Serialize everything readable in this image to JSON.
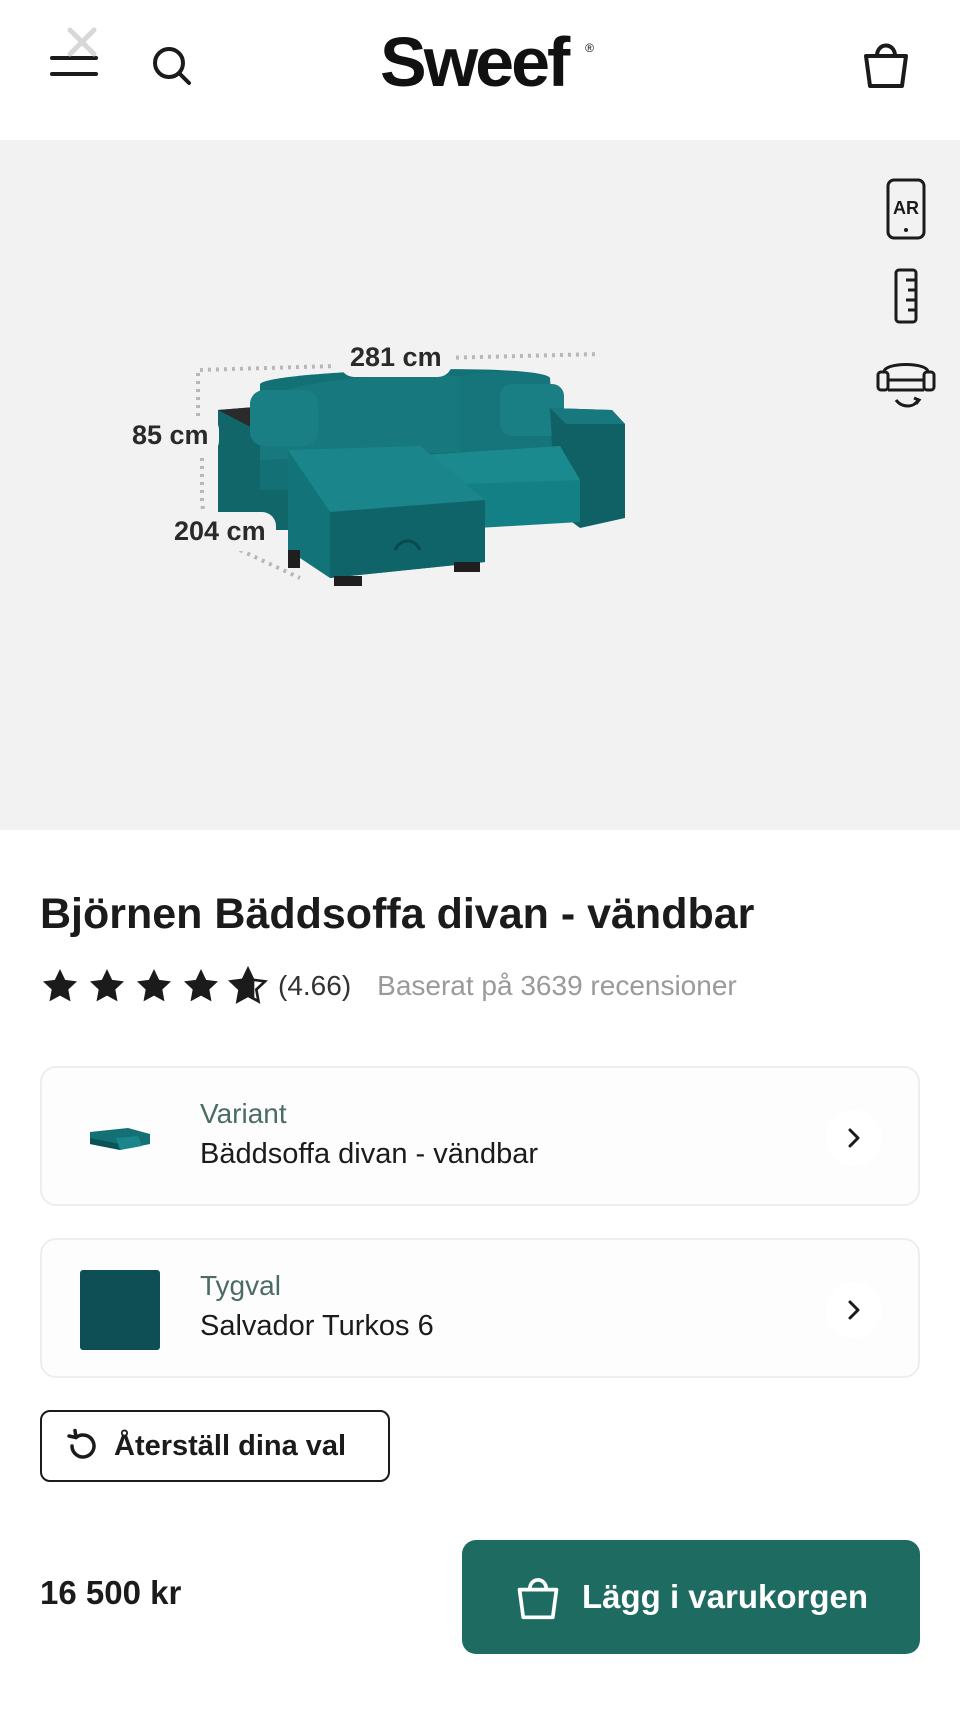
{
  "header": {
    "logo_text": "Sweef",
    "logo_mark": "®",
    "icons": [
      "menu-icon",
      "close-icon",
      "search-icon",
      "shopping-bag-icon"
    ]
  },
  "hero": {
    "tools": [
      "ar-phone-icon",
      "ruler-icon",
      "sofa-rotate-icon"
    ],
    "tool_labels": {
      "ar": "AR"
    },
    "dimensions": {
      "width": "281 cm",
      "height": "85 cm",
      "depth": "204 cm"
    },
    "colors": {
      "background": "#f2f2f2",
      "sofa": "#137074"
    }
  },
  "product": {
    "title": "Björnen Bäddsoffa divan - vändbar",
    "rating": {
      "stars": 4.66,
      "max": 5,
      "value_text": "(4.66)",
      "reviews_text": "Baserat på 3639 recensioner"
    }
  },
  "options": {
    "variant": {
      "label": "Variant",
      "value": "Bäddsoffa divan - vändbar"
    },
    "fabric": {
      "label": "Tygval",
      "value": "Salvador Turkos 6",
      "swatch_color": "#0e4e55"
    }
  },
  "reset": {
    "label": "Återställ dina val"
  },
  "purchase": {
    "price": "16 500 kr",
    "button_label": "Lägg i varukorgen",
    "button_color": "#1e6b62"
  }
}
